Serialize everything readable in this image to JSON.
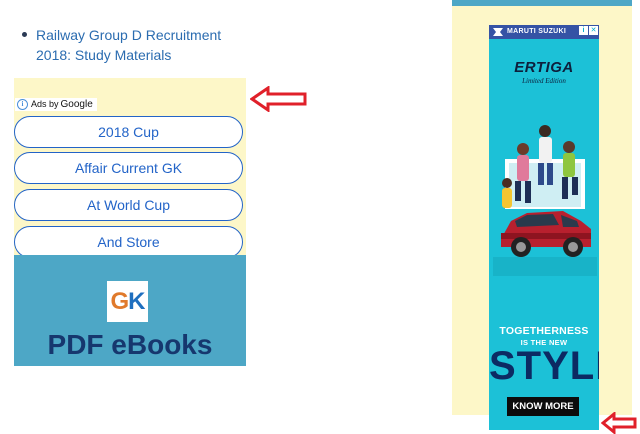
{
  "article": {
    "links": [
      {
        "lines": [
          "Railway Group D Recruitment",
          "2018: Study Materials"
        ]
      }
    ]
  },
  "left_ad": {
    "ads_by_prefix": "Ads by",
    "ads_by_brand": "Google",
    "info_glyph": "i",
    "buttons": [
      "2018 Cup",
      "Affair Current GK",
      "At World Cup",
      "And Store"
    ],
    "logo_g": "G",
    "logo_k": "K",
    "title": "PDF eBooks"
  },
  "right_ad": {
    "brand": "MARUTI SUZUKI",
    "adchoices_glyph": "i",
    "close_glyph": "✕",
    "model": "ERTIGA",
    "edition": "Limited Edition",
    "tagline_1": "TOGETHERNESS",
    "tagline_2": "IS THE NEW",
    "tagline_3": "STYLE",
    "cta": "KNOW MORE"
  },
  "colors": {
    "ad_background": "#fdf7c8",
    "button_border": "#2364c8",
    "gk_panel": "#4da7c6",
    "banner": "#1cc1d7",
    "arrow": "#e0202a"
  },
  "icons": [
    "info-icon",
    "adchoices-icon",
    "close-icon",
    "red-arrow-icon"
  ]
}
